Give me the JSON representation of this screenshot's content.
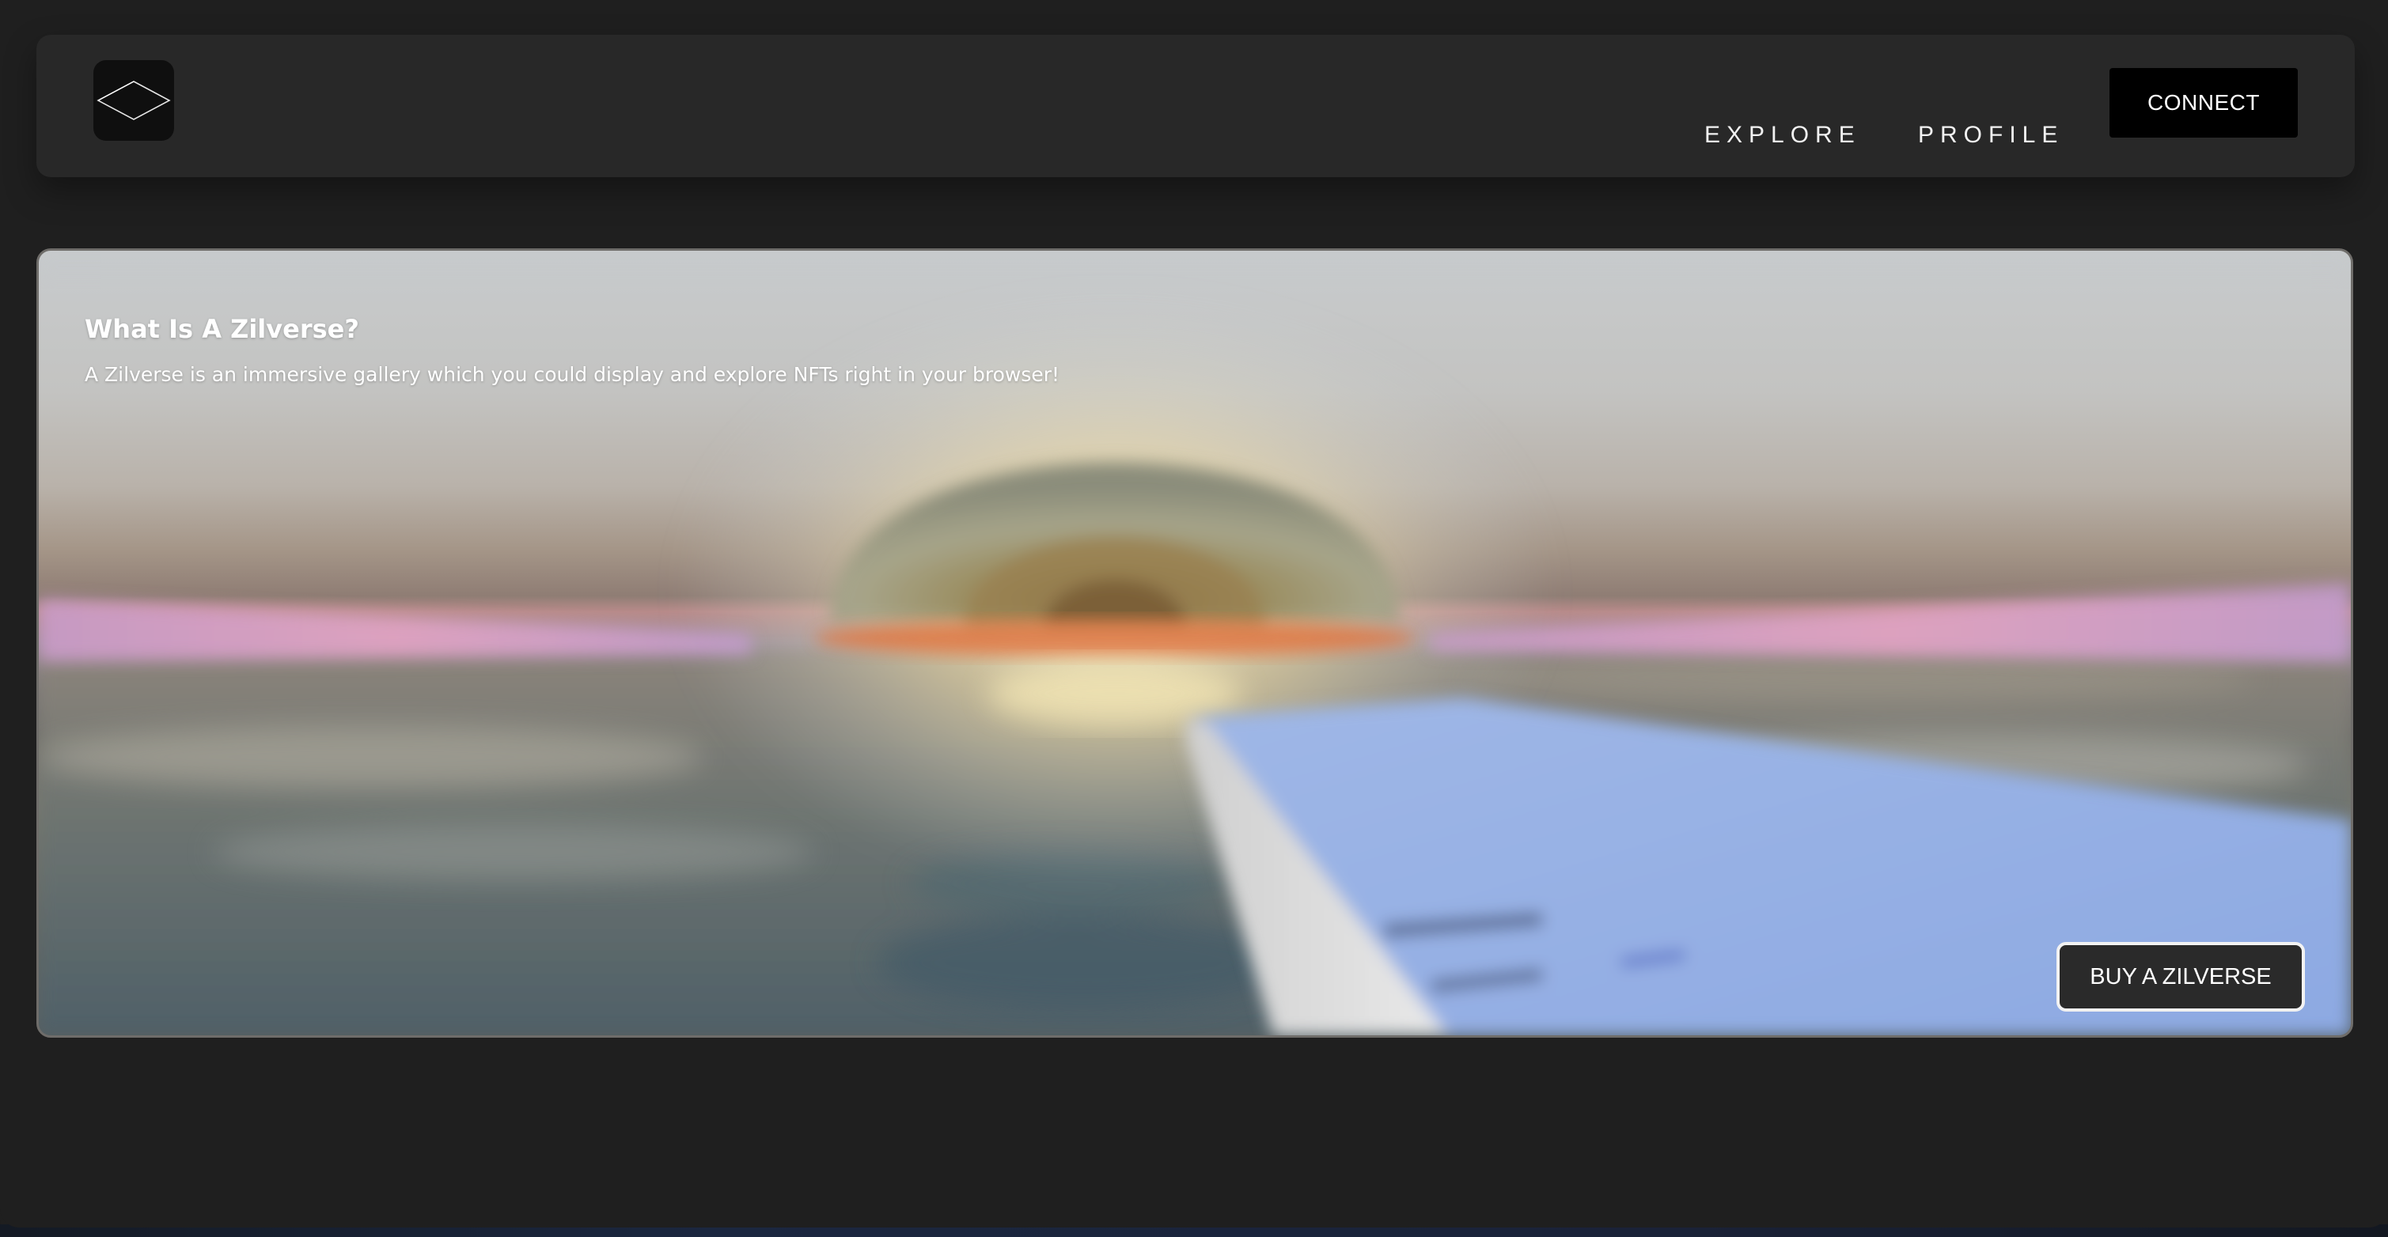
{
  "header": {
    "logo_icon": "diamond-logo-icon",
    "nav": [
      {
        "label": "EXPLORE"
      },
      {
        "label": "PROFILE"
      }
    ],
    "connect_label": "CONNECT"
  },
  "hero": {
    "title": "What Is A Zilverse?",
    "description": "A Zilverse is an immersive gallery which you could display and explore NFTs right in your browser!",
    "cta_label": "BUY A ZILVERSE",
    "background_image": "blurred-3d-sunset-seascape-scene"
  },
  "colors": {
    "page_background": "#1f1f1f",
    "navbar_background": "#282828",
    "connect_button": "#000000",
    "cta_button": "#2a2a2a"
  }
}
